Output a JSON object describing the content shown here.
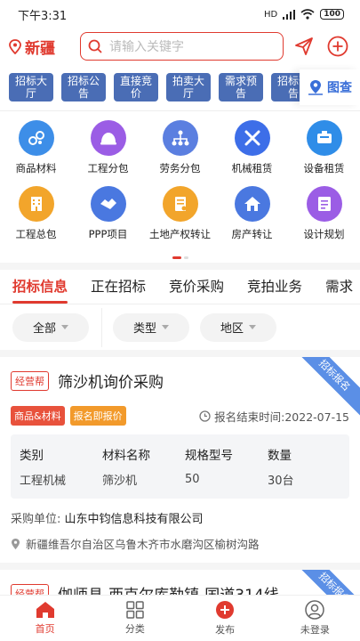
{
  "status": {
    "time": "下午3:31",
    "battery": "100",
    "network": "HD"
  },
  "header": {
    "location": "新疆",
    "search_placeholder": "请输入关键字"
  },
  "quick_tags": [
    {
      "label": "招标大厅"
    },
    {
      "label": "招标公告"
    },
    {
      "label": "直接竞价"
    },
    {
      "label": "拍卖大厅"
    },
    {
      "label": "需求预告"
    },
    {
      "label": "招标预告"
    }
  ],
  "map_button": "图查",
  "categories_row1": [
    {
      "label": "商品材料",
      "color": "#3d8ee8",
      "icon": "materials-icon"
    },
    {
      "label": "工程分包",
      "color": "#9b5de5",
      "icon": "helmet-icon"
    },
    {
      "label": "劳务分包",
      "color": "#5b7fe0",
      "icon": "org-chart-icon"
    },
    {
      "label": "机械租赁",
      "color": "#3d6ee8",
      "icon": "tools-icon"
    },
    {
      "label": "设备租赁",
      "color": "#2f8de8",
      "icon": "equipment-icon"
    }
  ],
  "categories_row2": [
    {
      "label": "工程总包",
      "color": "#f2a52b",
      "icon": "building-icon"
    },
    {
      "label": "PPP项目",
      "color": "#4a78e0",
      "icon": "handshake-icon"
    },
    {
      "label": "土地产权转让",
      "color": "#f2a52b",
      "icon": "land-doc-icon"
    },
    {
      "label": "房产转让",
      "color": "#4a78e0",
      "icon": "house-icon"
    },
    {
      "label": "设计规划",
      "color": "#9b5de5",
      "icon": "design-icon"
    }
  ],
  "tabs": [
    {
      "label": "招标信息"
    },
    {
      "label": "正在招标"
    },
    {
      "label": "竞价采购"
    },
    {
      "label": "竞拍业务"
    },
    {
      "label": "需求"
    }
  ],
  "filters": {
    "all": "全部",
    "type": "类型",
    "region": "地区"
  },
  "card1": {
    "ribbon": "招标报名",
    "badge": "经营帮",
    "title": "筛沙机询价采购",
    "chip1": "商品&材料",
    "chip2": "报名即报价",
    "deadline": "报名结束时间:2022-07-15",
    "table_headers": [
      "类别",
      "材料名称",
      "规格型号",
      "数量"
    ],
    "table_row": [
      "工程机械",
      "筛沙机",
      "50",
      "30台"
    ],
    "buyer_label": "采购单位:",
    "buyer": "山东中钧信息科技有限公司",
    "address": "新疆维吾尔自治区乌鲁木齐市水磨沟区榆树沟路"
  },
  "card2": {
    "ribbon": "招标报名",
    "badge": "经营帮",
    "title": "伽师县-西克尔库勒镇-国道314线..."
  },
  "bottom_nav": [
    {
      "label": "首页"
    },
    {
      "label": "分类"
    },
    {
      "label": "发布"
    },
    {
      "label": "未登录"
    }
  ]
}
